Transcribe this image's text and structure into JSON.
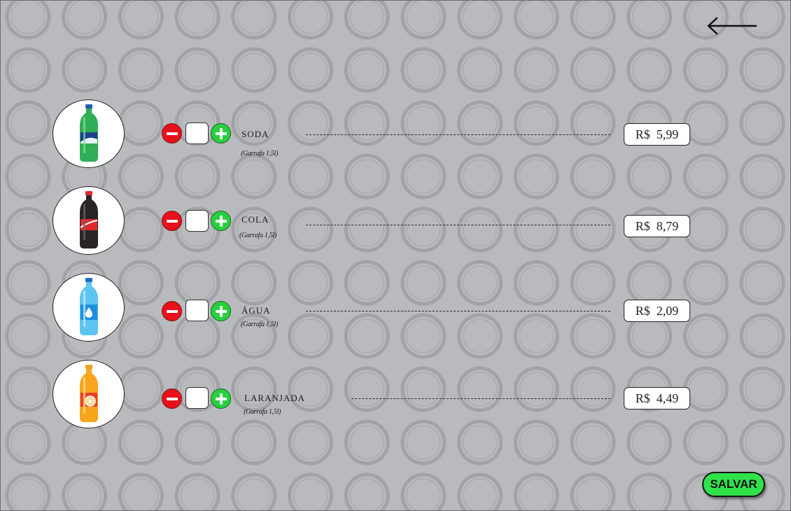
{
  "header": {
    "back_icon": "arrow-left-icon"
  },
  "products": [
    {
      "name": "Soda",
      "subtitle": "(Garrafa 1,5l)",
      "quantity": "",
      "currency": "R$",
      "price": "5,99",
      "icon": "green-soda-bottle-icon",
      "color": "#2aa84a"
    },
    {
      "name": "Cola",
      "subtitle": "(Garrafa 1,5l)",
      "quantity": "",
      "currency": "R$",
      "price": "8,79",
      "icon": "cola-bottle-icon",
      "color": "#e02a2a"
    },
    {
      "name": "Água",
      "subtitle": "(Garrafa 1,5l)",
      "quantity": "",
      "currency": "R$",
      "price": "2,09",
      "icon": "water-bottle-icon",
      "color": "#2a9de0"
    },
    {
      "name": "Laranjada",
      "subtitle": "(Garrafa 1,5l)",
      "quantity": "",
      "currency": "R$",
      "price": "4,49",
      "icon": "orange-soda-bottle-icon",
      "color": "#f5a11a"
    }
  ],
  "controls": {
    "decrease_icon": "minus-icon",
    "increase_icon": "plus-icon"
  },
  "footer": {
    "save_label": "SALVAR"
  },
  "colors": {
    "background": "#b9babd",
    "save_button": "#2fe24a",
    "minus_button": "#e8101a",
    "plus_button": "#27d03d"
  }
}
